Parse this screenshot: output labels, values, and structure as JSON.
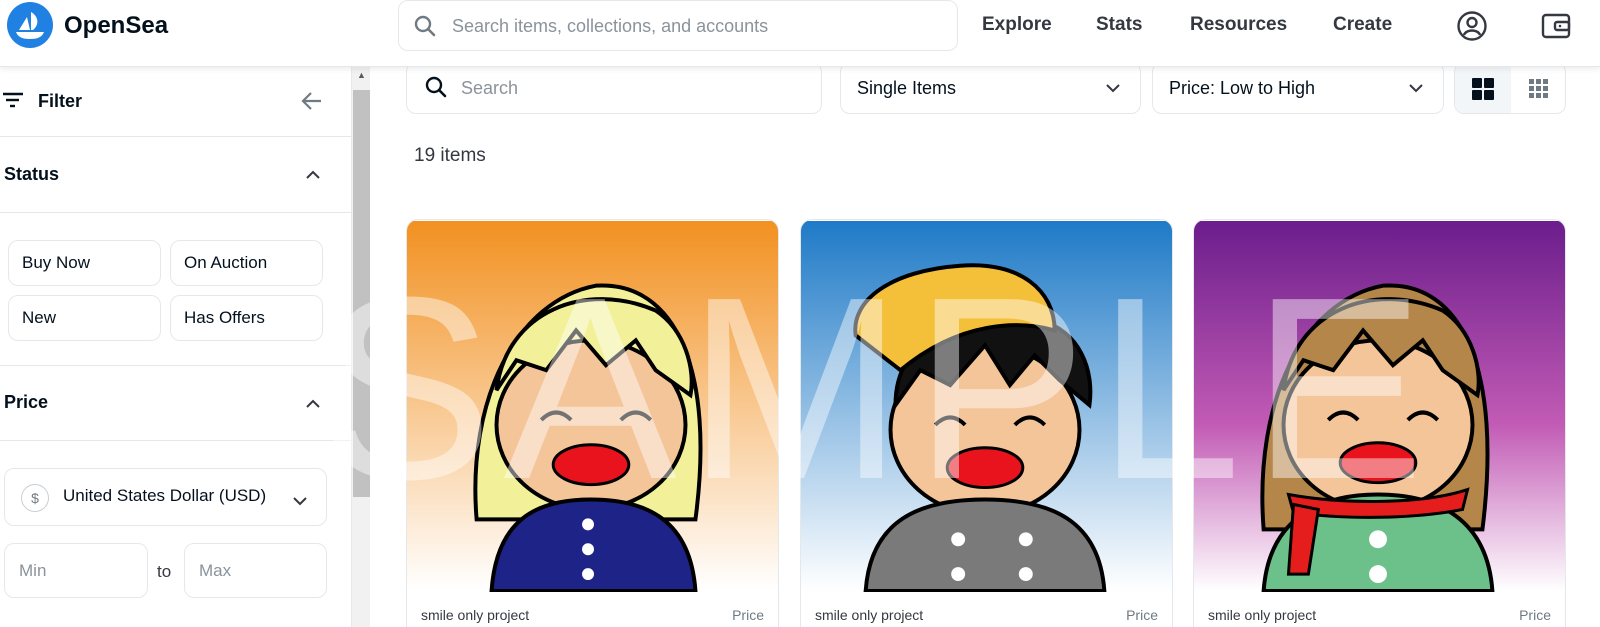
{
  "header": {
    "brand": "OpenSea",
    "search_placeholder": "Search items, collections, and accounts",
    "nav": [
      "Explore",
      "Stats",
      "Resources",
      "Create"
    ],
    "icons": [
      "profile-icon",
      "wallet-icon"
    ]
  },
  "sidebar": {
    "filter_title": "Filter",
    "status": {
      "title": "Status",
      "options": [
        "Buy Now",
        "On Auction",
        "New",
        "Has Offers"
      ]
    },
    "price": {
      "title": "Price",
      "currency_symbol": "$",
      "currency": "United States Dollar (USD)",
      "min_placeholder": "Min",
      "to_label": "to",
      "max_placeholder": "Max"
    }
  },
  "main": {
    "search_placeholder": "Search",
    "item_type": "Single Items",
    "sort": "Price: Low to High",
    "item_count": "19 items",
    "cards": [
      {
        "collection": "smile only project",
        "price_label": "Price",
        "bg_top": "#f29121",
        "bg_bottom": "#ffffff",
        "hair": "#f3f09a",
        "shirt": "#1d2387"
      },
      {
        "collection": "smile only project",
        "price_label": "Price",
        "bg_top": "#1f7ac7",
        "bg_bottom": "#ffffff",
        "hair": "#111111",
        "shirt": "#7a7a7a"
      },
      {
        "collection": "smile only project",
        "price_label": "Price",
        "bg_top": "#6b1d8c",
        "bg_bottom": "#ffffff",
        "hair": "#b4864a",
        "shirt": "#6cc08a"
      }
    ],
    "watermark": "SAMPLE"
  },
  "colors": {
    "accent": "#2081e2",
    "border": "#e5e8eb"
  }
}
